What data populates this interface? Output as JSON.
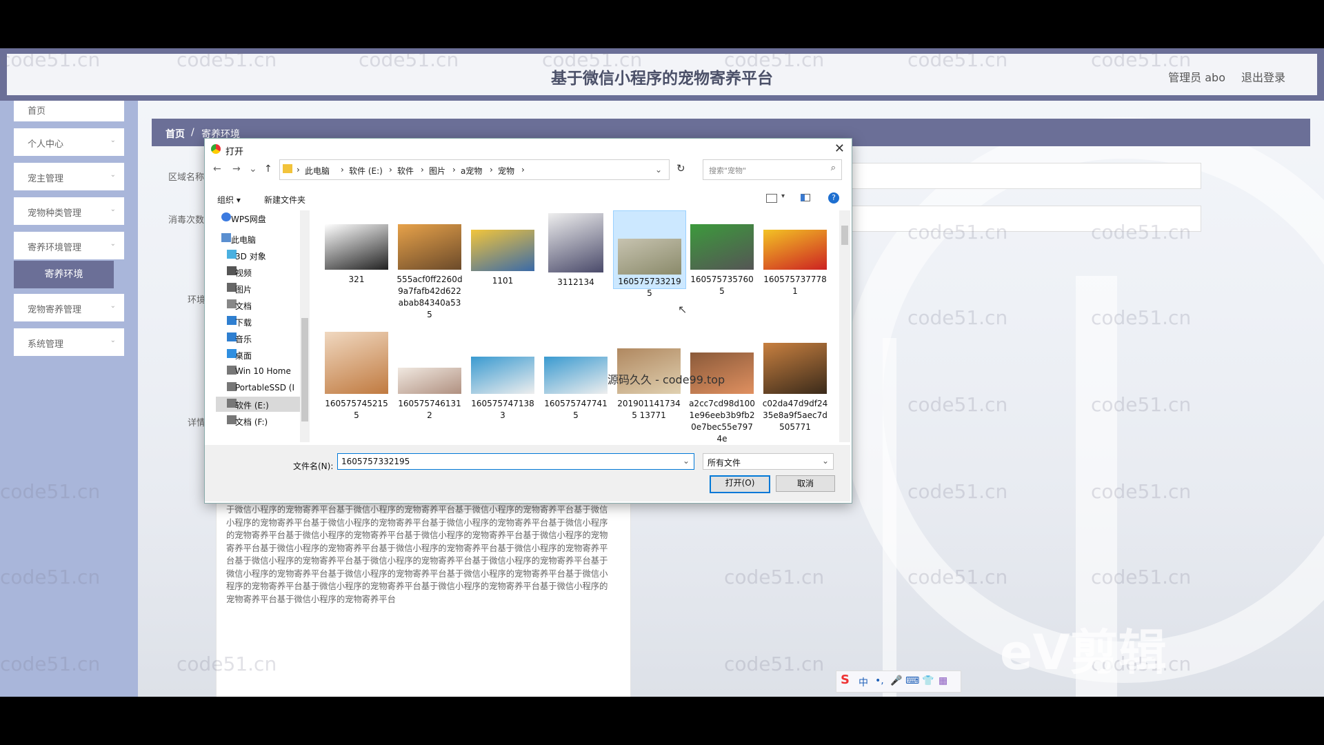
{
  "header": {
    "title": "基于微信小程序的宠物寄养平台",
    "admin": "管理员 abo",
    "logout": "退出登录"
  },
  "sidebar": {
    "items": [
      {
        "label": "首页"
      },
      {
        "label": "个人中心"
      },
      {
        "label": "宠主管理"
      },
      {
        "label": "宠物种类管理"
      },
      {
        "label": "寄养环境管理"
      },
      {
        "label": "寄养环境"
      },
      {
        "label": "宠物寄养管理"
      },
      {
        "label": "系统管理"
      }
    ]
  },
  "breadcrumb": {
    "home": "首页",
    "sep": "/",
    "current": "寄养环境"
  },
  "form": {
    "labels": [
      "区域名称",
      "消毒次数",
      "环境",
      "详情"
    ]
  },
  "description": "于微信小程序的宠物寄养平台基于微信小程序的宠物寄养平台基于微信小程序的宠物寄养平台基于微信小程序的宠物寄养平台基于微信小程序的宠物寄养平台基于微信小程序的宠物寄养平台基于微信小程序的宠物寄养平台基于微信小程序的宠物寄养平台基于微信小程序的宠物寄养平台基于微信小程序的宠物寄养平台基于微信小程序的宠物寄养平台基于微信小程序的宠物寄养平台基于微信小程序的宠物寄养平台基于微信小程序的宠物寄养平台基于微信小程序的宠物寄养平台基于微信小程序的宠物寄养平台基于微信小程序的宠物寄养平台基于微信小程序的宠物寄养平台基于微信小程序的宠物寄养平台基于微信小程序的宠物寄养平台基于微信小程序的宠物寄养平台基于微信小程序的宠物寄养平台基于微信小程序的宠物寄养平台基于微信小程序的宠物寄养平台",
  "dialog": {
    "title": "打开",
    "close": "✕",
    "path": [
      "此电脑",
      "软件 (E:)",
      "软件",
      "图片",
      "a宠物",
      "宠物"
    ],
    "search_placeholder": "搜索\"宠物\"",
    "organize": "组织 ▾",
    "new_folder": "新建文件夹",
    "nav": [
      {
        "label": "WPS网盘",
        "color": "#3c7be0"
      },
      {
        "label": "此电脑",
        "color": "#5a8fd0"
      },
      {
        "label": "3D 对象",
        "color": "#4ab0e0"
      },
      {
        "label": "视频",
        "color": "#555"
      },
      {
        "label": "图片",
        "color": "#666"
      },
      {
        "label": "文档",
        "color": "#888"
      },
      {
        "label": "下载",
        "color": "#2f7fd0"
      },
      {
        "label": "音乐",
        "color": "#2f7fd0"
      },
      {
        "label": "桌面",
        "color": "#2f8fe0"
      },
      {
        "label": "Win 10 Home",
        "color": "#777"
      },
      {
        "label": "PortableSSD (I",
        "color": "#777"
      },
      {
        "label": "软件 (E:)",
        "color": "#777"
      },
      {
        "label": "文档 (F:)",
        "color": "#777"
      }
    ],
    "files": [
      {
        "name": "321",
        "colors": [
          "#fff",
          "#222"
        ]
      },
      {
        "name": "555acf0ff2260d9a7fafb42d622abab84340a535",
        "colors": [
          "#e7a24a",
          "#6b4a2a"
        ]
      },
      {
        "name": "1101",
        "colors": [
          "#f2c53b",
          "#3a6aa8"
        ]
      },
      {
        "name": "3112134",
        "colors": [
          "#eee",
          "#4a4a6a"
        ]
      },
      {
        "name": "1605757332195",
        "colors": [
          "#c7c3b0",
          "#8a8a6a"
        ]
      },
      {
        "name": "1605757357605",
        "colors": [
          "#3c9a3c",
          "#555"
        ]
      },
      {
        "name": "1605757377781",
        "colors": [
          "#f3c325",
          "#c22"
        ]
      },
      {
        "name": "1605757452155",
        "colors": [
          "#f0d8c0",
          "#c07a40"
        ]
      },
      {
        "name": "1605757461312",
        "colors": [
          "#f0e8e0",
          "#b09080"
        ]
      },
      {
        "name": "1605757471383",
        "colors": [
          "#3a9ad0",
          "#eee"
        ]
      },
      {
        "name": "1605757477415",
        "colors": [
          "#3a9ad0",
          "#eee"
        ]
      },
      {
        "name": "2019011417345 13771",
        "colors": [
          "#b08860",
          "#e0d0b0"
        ]
      },
      {
        "name": "a2cc7cd98d1001e96eeb3b9fb20e7bec55e7974e",
        "colors": [
          "#8a5a3a",
          "#e09060"
        ]
      },
      {
        "name": "c02da47d9df2435e8a9f5aec7d505771",
        "colors": [
          "#c88040",
          "#3a2a1a"
        ]
      }
    ],
    "watermark": "源码久久 - code99.top",
    "filename_label": "文件名(N):",
    "filename_value": "1605757332195",
    "filetype": "所有文件",
    "open_btn": "打开(O)",
    "cancel_btn": "取消"
  },
  "bg_watermark": "code51.cn",
  "ime": {
    "items": [
      "S",
      "中",
      "•,",
      "🎤",
      "⌨",
      "👕",
      "▦"
    ]
  },
  "ev_logo": "eV剪辑"
}
